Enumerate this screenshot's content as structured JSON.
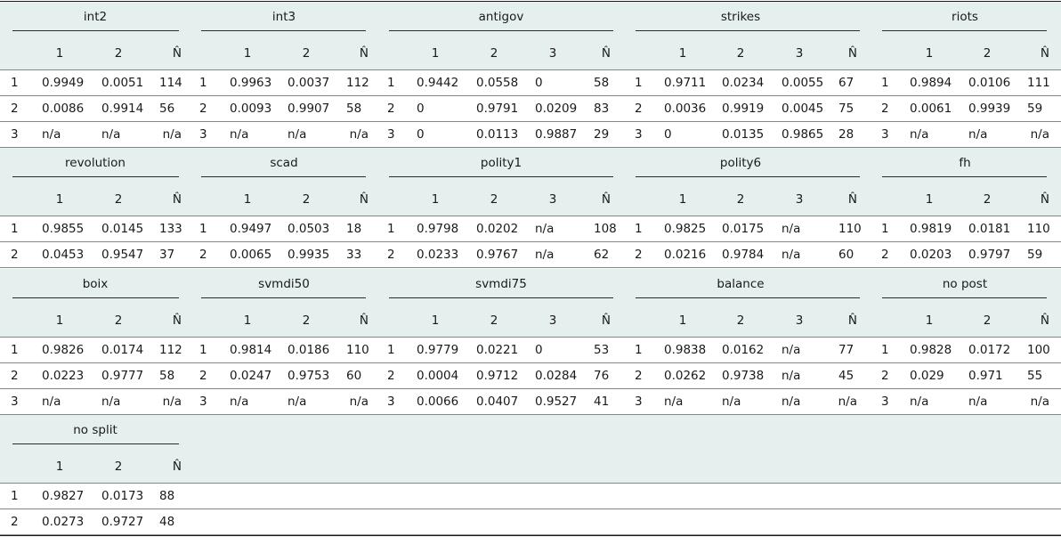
{
  "stub_labels": [
    "1",
    "2",
    "3"
  ],
  "n_label": "N̂",
  "groups": [
    [
      {
        "name": "int2",
        "cols": [
          "1",
          "2"
        ],
        "rows": [
          [
            "0.9949",
            "0.0051",
            "114"
          ],
          [
            "0.0086",
            "0.9914",
            "56"
          ],
          [
            "n/a",
            "n/a",
            "n/a"
          ]
        ]
      },
      {
        "name": "int3",
        "cols": [
          "1",
          "2"
        ],
        "rows": [
          [
            "0.9963",
            "0.0037",
            "112"
          ],
          [
            "0.0093",
            "0.9907",
            "58"
          ],
          [
            "n/a",
            "n/a",
            "n/a"
          ]
        ]
      },
      {
        "name": "antigov",
        "cols": [
          "1",
          "2",
          "3"
        ],
        "rows": [
          [
            "0.9442",
            "0.0558",
            "0",
            "58"
          ],
          [
            "0",
            "0.9791",
            "0.0209",
            "83"
          ],
          [
            "0",
            "0.0113",
            "0.9887",
            "29"
          ]
        ]
      },
      {
        "name": "strikes",
        "cols": [
          "1",
          "2",
          "3"
        ],
        "rows": [
          [
            "0.9711",
            "0.0234",
            "0.0055",
            "67"
          ],
          [
            "0.0036",
            "0.9919",
            "0.0045",
            "75"
          ],
          [
            "0",
            "0.0135",
            "0.9865",
            "28"
          ]
        ]
      },
      {
        "name": "riots",
        "cols": [
          "1",
          "2"
        ],
        "rows": [
          [
            "0.9894",
            "0.0106",
            "111"
          ],
          [
            "0.0061",
            "0.9939",
            "59"
          ],
          [
            "n/a",
            "n/a",
            "n/a"
          ]
        ]
      }
    ],
    [
      {
        "name": "revolution",
        "cols": [
          "1",
          "2"
        ],
        "rows": [
          [
            "0.9855",
            "0.0145",
            "133"
          ],
          [
            "0.0453",
            "0.9547",
            "37"
          ]
        ]
      },
      {
        "name": "scad",
        "cols": [
          "1",
          "2"
        ],
        "rows": [
          [
            "0.9497",
            "0.0503",
            "18"
          ],
          [
            "0.0065",
            "0.9935",
            "33"
          ]
        ]
      },
      {
        "name": "polity1",
        "cols": [
          "1",
          "2",
          "3"
        ],
        "rows": [
          [
            "0.9798",
            "0.0202",
            "n/a",
            "108"
          ],
          [
            "0.0233",
            "0.9767",
            "n/a",
            "62"
          ]
        ]
      },
      {
        "name": "polity6",
        "cols": [
          "1",
          "2",
          "3"
        ],
        "rows": [
          [
            "0.9825",
            "0.0175",
            "n/a",
            "110"
          ],
          [
            "0.0216",
            "0.9784",
            "n/a",
            "60"
          ]
        ]
      },
      {
        "name": "fh",
        "cols": [
          "1",
          "2"
        ],
        "rows": [
          [
            "0.9819",
            "0.0181",
            "110"
          ],
          [
            "0.0203",
            "0.9797",
            "59"
          ]
        ]
      }
    ],
    [
      {
        "name": "boix",
        "cols": [
          "1",
          "2"
        ],
        "rows": [
          [
            "0.9826",
            "0.0174",
            "112"
          ],
          [
            "0.0223",
            "0.9777",
            "58"
          ],
          [
            "n/a",
            "n/a",
            "n/a"
          ]
        ]
      },
      {
        "name": "svmdi50",
        "cols": [
          "1",
          "2"
        ],
        "rows": [
          [
            "0.9814",
            "0.0186",
            "110"
          ],
          [
            "0.0247",
            "0.9753",
            "60"
          ],
          [
            "n/a",
            "n/a",
            "n/a"
          ]
        ]
      },
      {
        "name": "svmdi75",
        "cols": [
          "1",
          "2",
          "3"
        ],
        "rows": [
          [
            "0.9779",
            "0.0221",
            "0",
            "53"
          ],
          [
            "0.0004",
            "0.9712",
            "0.0284",
            "76"
          ],
          [
            "0.0066",
            "0.0407",
            "0.9527",
            "41"
          ]
        ]
      },
      {
        "name": "balance",
        "cols": [
          "1",
          "2",
          "3"
        ],
        "rows": [
          [
            "0.9838",
            "0.0162",
            "n/a",
            "77"
          ],
          [
            "0.0262",
            "0.9738",
            "n/a",
            "45"
          ],
          [
            "n/a",
            "n/a",
            "n/a",
            "n/a"
          ]
        ]
      },
      {
        "name": "no post",
        "cols": [
          "1",
          "2"
        ],
        "rows": [
          [
            "0.9828",
            "0.0172",
            "100"
          ],
          [
            "0.029",
            "0.971",
            "55"
          ],
          [
            "n/a",
            "n/a",
            "n/a"
          ]
        ]
      }
    ],
    [
      {
        "name": "no split",
        "cols": [
          "1",
          "2"
        ],
        "rows": [
          [
            "0.9827",
            "0.0173",
            "88"
          ],
          [
            "0.0273",
            "0.9727",
            "48"
          ]
        ]
      }
    ]
  ]
}
